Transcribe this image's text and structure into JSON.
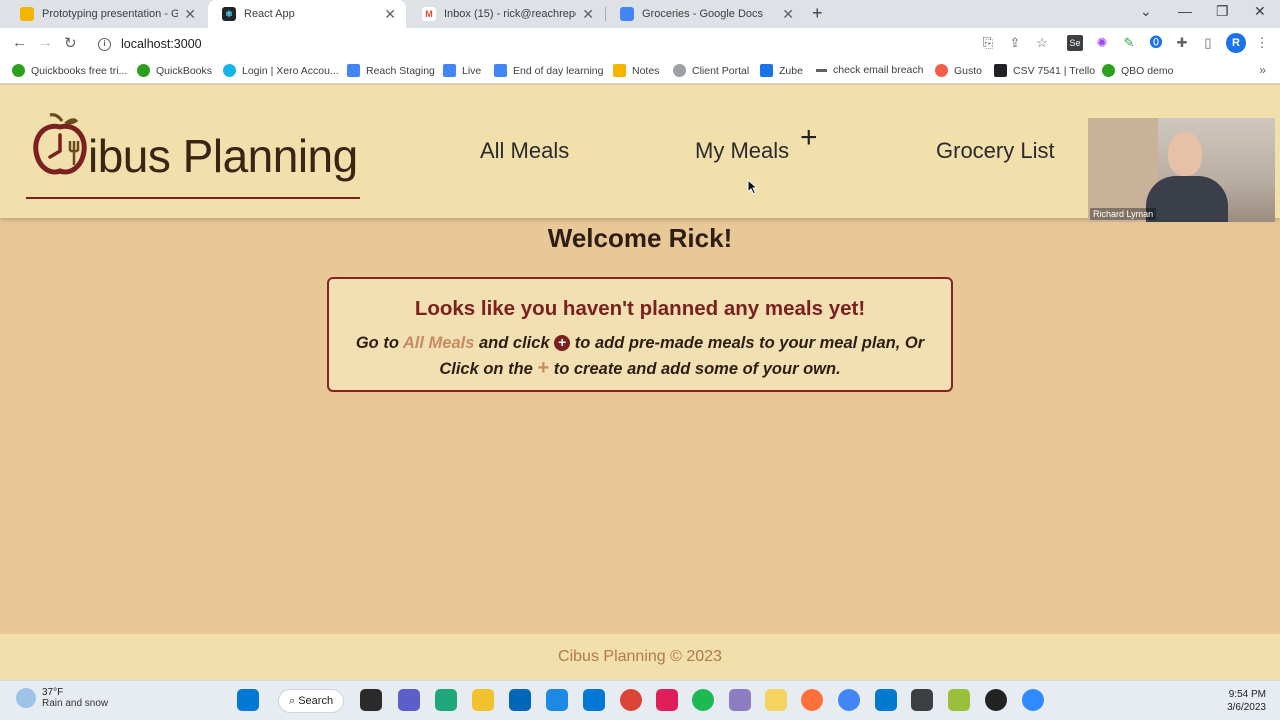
{
  "browser": {
    "tabs": [
      {
        "title": "Prototyping presentation - Goog",
        "favicon": "slides-icon",
        "color": "#f4b400"
      },
      {
        "title": "React App",
        "favicon": "react-icon",
        "color": "#20232a"
      },
      {
        "title": "Inbox (15) - rick@reachreporting",
        "favicon": "gmail-icon",
        "color": "#ea4335"
      },
      {
        "title": "Groceries - Google Docs",
        "favicon": "docs-icon",
        "color": "#4285f4"
      }
    ],
    "url": "localhost:3000",
    "profile_initial": "R",
    "bookmarks": [
      {
        "label": "Quickbooks free tri...",
        "color": "#2ca01c"
      },
      {
        "label": "QuickBooks",
        "color": "#2ca01c"
      },
      {
        "label": "Login | Xero Accou...",
        "color": "#13b5ea"
      },
      {
        "label": "Reach Staging",
        "color": "#4285f4"
      },
      {
        "label": "Live",
        "color": "#4285f4"
      },
      {
        "label": "End of day learning",
        "color": "#4285f4"
      },
      {
        "label": "Notes",
        "color": "#f4b400"
      },
      {
        "label": "Client Portal",
        "color": "#9aa0a6"
      },
      {
        "label": "Zube",
        "color": "#1a73e8"
      },
      {
        "label": "check email breach",
        "color": "#5f6368"
      },
      {
        "label": "Gusto",
        "color": "#f45d48"
      },
      {
        "label": "CSV 7541 | Trello",
        "color": "#202124"
      },
      {
        "label": "QBO demo",
        "color": "#2ca01c"
      }
    ]
  },
  "app": {
    "logo_text": "ibus Planning",
    "nav": {
      "all_meals": "All Meals",
      "my_meals": "My Meals",
      "my_meals_plus": "+",
      "grocery_list": "Grocery List"
    },
    "welcome": "Welcome Rick!",
    "notice": {
      "heading": "Looks like you haven't planned any meals yet!",
      "line1_pre": "Go to ",
      "line1_link": "All Meals",
      "line1_mid": " and click ",
      "line1_icon": "+",
      "line1_post": " to add pre-made meals to your meal plan, Or",
      "line2_pre": "Click on the ",
      "line2_icon": "+",
      "line2_post": " to create and add some of your own."
    },
    "footer": "Cibus Planning © 2023",
    "colors": {
      "accent": "#7b1f1f",
      "link": "#c88a62",
      "header_bg": "#f1dfac",
      "page_bg": "#e8c896"
    }
  },
  "video": {
    "participant": "Richard Lyman"
  },
  "taskbar": {
    "temp": "37°F",
    "weather": "Rain and snow",
    "search_label": "Search",
    "time": "9:54 PM",
    "date": "3/6/2023"
  }
}
